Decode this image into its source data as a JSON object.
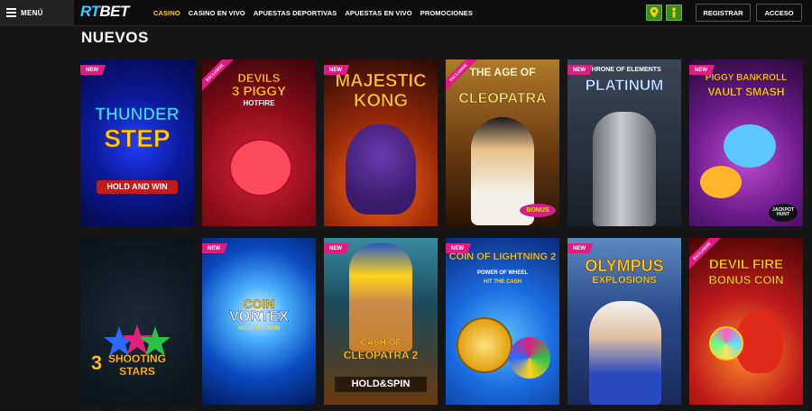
{
  "header": {
    "menu_label": "MENÚ",
    "logo_rt": "RT",
    "logo_bet": "BET",
    "nav": [
      "CASINO",
      "CASINO EN VIVO",
      "APUESTAS DEPORTIVAS",
      "APUESTAS EN VIVO",
      "PROMOCIONES"
    ],
    "active_nav": "CASINO",
    "icons": [
      "location-icon",
      "person-info-icon"
    ],
    "register_label": "REGISTRAR",
    "login_label": "ACCESO"
  },
  "section": {
    "title": "NUEVOS"
  },
  "badges": {
    "new": "NEW",
    "exclusive": "EXCLUSIVE"
  },
  "games": [
    {
      "t1": "THUNDER",
      "t2": "STEP",
      "t3": "HOLD AND WIN"
    },
    {
      "t1": "DEVILS",
      "t2": "3 PIGGY",
      "t3": "HOTFIRE"
    },
    {
      "t1": "MAJESTIC",
      "t2": "KONG",
      "t3": ""
    },
    {
      "t1": "THE AGE OF",
      "t2": "CLEOPATRA",
      "t3": "BONUS"
    },
    {
      "t1": "THRONE OF ELEMENTS",
      "t2": "PLATINUM",
      "t3": ""
    },
    {
      "t1": "PIGGY BANKROLL",
      "t2": "VAULT SMASH",
      "t3": "JACKPOT HUNT"
    },
    {
      "t1": "3",
      "t2": "SHOOTING",
      "t3": "STARS"
    },
    {
      "t1": "COIN",
      "t2": "VORTEX",
      "t3": "HOLD THE SPIN"
    },
    {
      "t1": "CASH OF",
      "t2": "CLEOPATRA 2",
      "t3": "HOLD&SPIN"
    },
    {
      "t1": "COIN OF LIGHTNING 2",
      "t2": "POWER OF WHEEL",
      "t3": "HIT THE CASH"
    },
    {
      "t1": "OLYMPUS",
      "t2": "EXPLOSIONS",
      "t3": ""
    },
    {
      "t1": "DEVIL FIRE",
      "t2": "BONUS COIN",
      "t3": ""
    }
  ]
}
